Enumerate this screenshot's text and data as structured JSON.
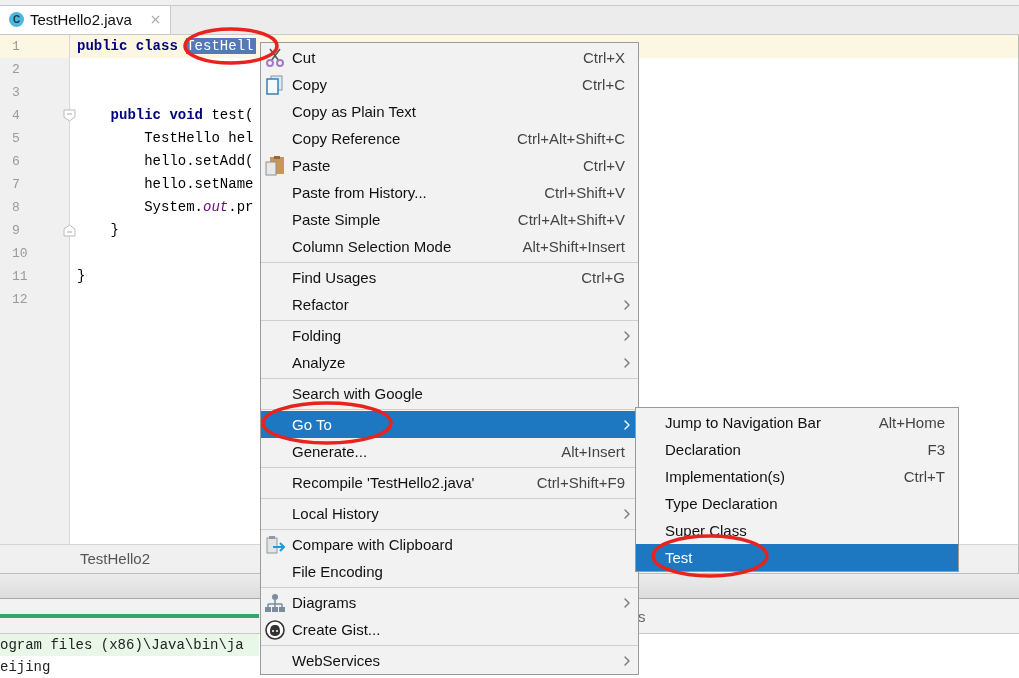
{
  "tab": {
    "title": "TestHello2.java",
    "icon": "C",
    "selected": true
  },
  "editor": {
    "lines": [
      {
        "number": "1",
        "current": true,
        "tokens": [
          {
            "kind": "keyword",
            "text": "public class "
          },
          {
            "kind": "selection",
            "text": "TestHell",
            "circled": true
          }
        ]
      },
      {
        "number": "2",
        "current": false
      },
      {
        "number": "3",
        "current": false
      },
      {
        "number": "4",
        "current": false,
        "fold_start": true,
        "tokens": [
          {
            "kind": "keyword",
            "text": "    public void "
          },
          {
            "kind": "plain",
            "text": "test("
          }
        ]
      },
      {
        "number": "5",
        "current": false,
        "tokens": [
          {
            "kind": "plain",
            "text": "        TestHello hel"
          }
        ]
      },
      {
        "number": "6",
        "current": false,
        "tokens": [
          {
            "kind": "plain",
            "text": "        hello.setAdd("
          }
        ]
      },
      {
        "number": "7",
        "current": false,
        "tokens": [
          {
            "kind": "plain",
            "text": "        hello.setName"
          }
        ]
      },
      {
        "number": "8",
        "current": false,
        "tokens": [
          {
            "kind": "plain",
            "text": "        System."
          },
          {
            "kind": "field",
            "text": "out"
          },
          {
            "kind": "plain",
            "text": ".pr"
          }
        ]
      },
      {
        "number": "9",
        "current": false,
        "fold_end": true,
        "tokens": [
          {
            "kind": "plain",
            "text": "    }"
          }
        ]
      },
      {
        "number": "10",
        "current": false
      },
      {
        "number": "11",
        "current": false,
        "tokens": [
          {
            "kind": "plain",
            "text": "}"
          }
        ]
      },
      {
        "number": "12",
        "current": false
      }
    ]
  },
  "breadcrumb": "TestHello2",
  "tool_window": {
    "tab_fragment": "s"
  },
  "console": {
    "lines": [
      {
        "text": "ogram files (x86)\\Java\\bin\\ja",
        "command": true
      },
      {
        "text": "eijing",
        "command": false
      }
    ]
  },
  "context_menu": {
    "groups": [
      [
        {
          "kind": "cut",
          "label": "Cut",
          "shortcut": "Ctrl+X",
          "submenu": false,
          "selected": false
        },
        {
          "kind": "copy",
          "label": "Copy",
          "shortcut": "Ctrl+C",
          "submenu": false,
          "selected": false
        },
        {
          "kind": "plain",
          "label": "Copy as Plain Text",
          "submenu": false,
          "selected": false
        },
        {
          "kind": "plain",
          "label": "Copy Reference",
          "shortcut": "Ctrl+Alt+Shift+C",
          "submenu": false,
          "selected": false
        },
        {
          "kind": "paste",
          "label": "Paste",
          "shortcut": "Ctrl+V",
          "submenu": false,
          "selected": false
        },
        {
          "kind": "plain",
          "label": "Paste from History...",
          "shortcut": "Ctrl+Shift+V",
          "submenu": false,
          "selected": false
        },
        {
          "kind": "plain",
          "label": "Paste Simple",
          "shortcut": "Ctrl+Alt+Shift+V",
          "submenu": false,
          "selected": false
        },
        {
          "kind": "plain",
          "label": "Column Selection Mode",
          "shortcut": "Alt+Shift+Insert",
          "submenu": false,
          "selected": false
        }
      ],
      [
        {
          "kind": "plain",
          "label": "Find Usages",
          "shortcut": "Ctrl+G",
          "submenu": false,
          "selected": false
        },
        {
          "kind": "plain",
          "label": "Refactor",
          "submenu": true,
          "selected": false
        }
      ],
      [
        {
          "kind": "plain",
          "label": "Folding",
          "submenu": true,
          "selected": false
        },
        {
          "kind": "plain",
          "label": "Analyze",
          "submenu": true,
          "selected": false
        }
      ],
      [
        {
          "kind": "plain",
          "label": "Search with Google",
          "submenu": false,
          "selected": false
        }
      ],
      [
        {
          "kind": "plain",
          "label": "Go To",
          "submenu": true,
          "selected": true,
          "circled": true
        },
        {
          "kind": "plain",
          "label": "Generate...",
          "shortcut": "Alt+Insert",
          "submenu": false,
          "selected": false
        }
      ],
      [
        {
          "kind": "plain",
          "label": "Recompile 'TestHello2.java'",
          "shortcut": "Ctrl+Shift+F9",
          "submenu": false,
          "selected": false
        }
      ],
      [
        {
          "kind": "plain",
          "label": "Local History",
          "submenu": true,
          "selected": false
        }
      ],
      [
        {
          "kind": "compare",
          "label": "Compare with Clipboard",
          "submenu": false,
          "selected": false
        },
        {
          "kind": "plain",
          "label": "File Encoding",
          "submenu": false,
          "selected": false
        }
      ],
      [
        {
          "kind": "diagrams",
          "label": "Diagrams",
          "submenu": true,
          "selected": false
        },
        {
          "kind": "gist",
          "label": "Create Gist...",
          "submenu": false,
          "selected": false
        }
      ],
      [
        {
          "kind": "plain",
          "label": "WebServices",
          "submenu": true,
          "selected": false
        }
      ]
    ]
  },
  "submenu": {
    "items": [
      {
        "label": "Jump to Navigation Bar",
        "shortcut": "Alt+Home",
        "selected": false
      },
      {
        "label": "Declaration",
        "shortcut": "F3",
        "selected": false
      },
      {
        "label": "Implementation(s)",
        "shortcut": "Ctrl+T",
        "selected": false
      },
      {
        "label": "Type Declaration",
        "selected": false
      },
      {
        "label": "Super Class",
        "selected": false
      },
      {
        "label": "Test",
        "selected": true,
        "circled": true
      }
    ]
  }
}
